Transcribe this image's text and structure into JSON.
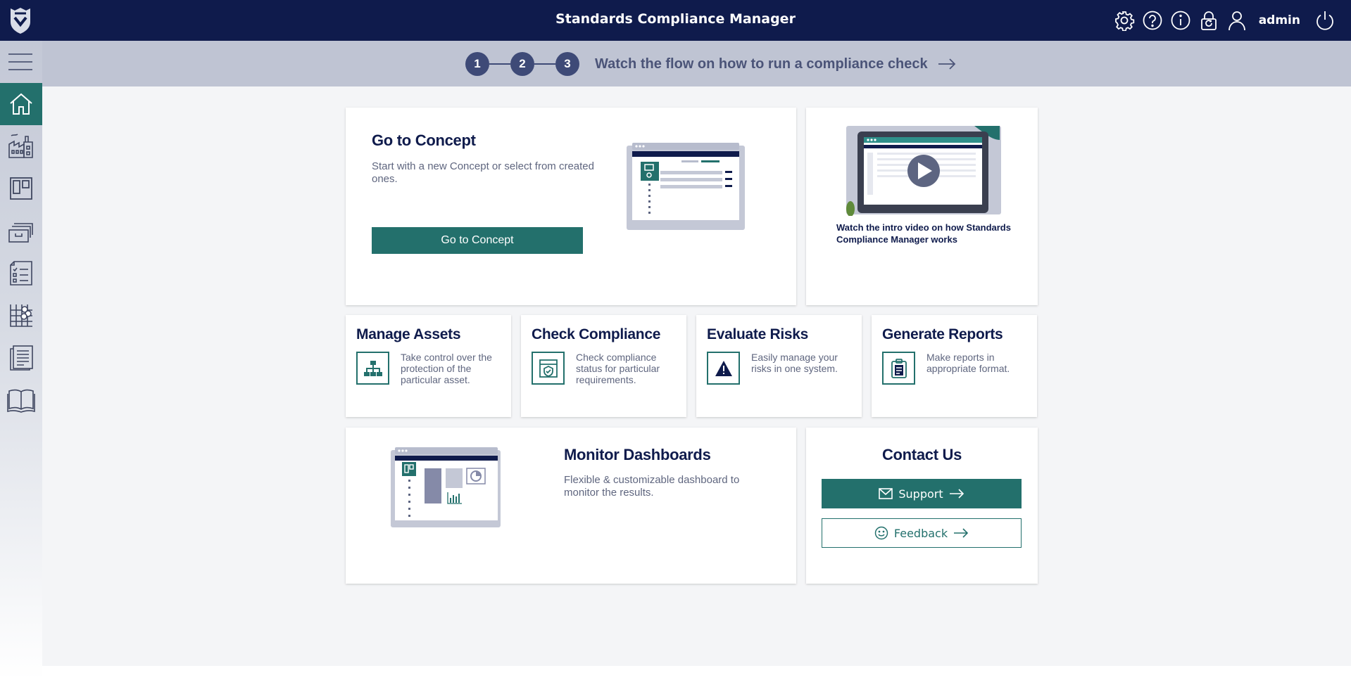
{
  "header": {
    "title": "Standards Compliance Manager",
    "username": "admin",
    "icons": [
      "settings-icon",
      "help-icon",
      "info-icon",
      "lock-icon",
      "user-icon",
      "power-icon"
    ]
  },
  "sidebar": {
    "items": [
      {
        "name": "home",
        "icon": "home-icon",
        "active": true
      },
      {
        "name": "factory",
        "icon": "factory-icon"
      },
      {
        "name": "boards",
        "icon": "board-icon"
      },
      {
        "name": "archive",
        "icon": "archive-icon"
      },
      {
        "name": "checklist",
        "icon": "checklist-icon"
      },
      {
        "name": "grid",
        "icon": "grid-icon"
      },
      {
        "name": "reports",
        "icon": "report-list-icon"
      },
      {
        "name": "guide",
        "icon": "book-icon"
      }
    ]
  },
  "steps": {
    "numbers": [
      "1",
      "2",
      "3"
    ],
    "link_text": "Watch the flow on how to run a compliance check"
  },
  "concept": {
    "title": "Go to Concept",
    "description": "Start with a new Concept or select from created ones.",
    "button_label": "Go to Concept"
  },
  "video": {
    "caption": "Watch the intro video on how Standards Compliance Manager works"
  },
  "features": [
    {
      "title": "Manage Assets",
      "description": "Take control over the protection of the particular asset.",
      "icon": "hierarchy-icon"
    },
    {
      "title": "Check Compliance",
      "description": "Check compliance status for particular requirements.",
      "icon": "compliance-icon"
    },
    {
      "title": "Evaluate Risks",
      "description": "Easily manage your risks in one system.",
      "icon": "warning-icon"
    },
    {
      "title": "Generate Reports",
      "description": "Make reports in appropriate format.",
      "icon": "clipboard-icon"
    }
  ],
  "dashboards": {
    "title": "Monitor Dashboards",
    "description": "Flexible & customizable dashboard to monitor the results."
  },
  "contact": {
    "title": "Contact Us",
    "support_label": "Support",
    "feedback_label": "Feedback"
  },
  "colors": {
    "navy": "#0f1b4c",
    "teal": "#23706c",
    "step": "#3e4a77",
    "banner": "#bfc4d3"
  }
}
